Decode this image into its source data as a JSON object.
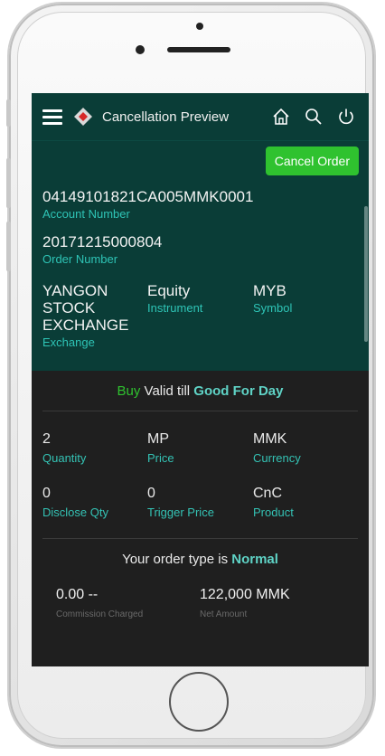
{
  "header": {
    "title": "Cancellation Preview"
  },
  "actions": {
    "cancel_order": "Cancel Order"
  },
  "account": {
    "value": "04149101821CA005MMK0001",
    "label": "Account Number"
  },
  "order": {
    "value": "20171215000804",
    "label": "Order Number"
  },
  "exchange": {
    "value_lines": [
      "YANGON",
      "STOCK",
      "EXCHANGE"
    ],
    "label": "Exchange"
  },
  "instrument": {
    "value": "Equity",
    "label": "Instrument"
  },
  "symbol": {
    "value": "MYB",
    "label": "Symbol"
  },
  "validity": {
    "side": "Buy",
    "text": "Valid till",
    "period": "Good For Day"
  },
  "quantity": {
    "value": "2",
    "label": "Quantity"
  },
  "price": {
    "value": "MP",
    "label": "Price"
  },
  "currency": {
    "value": "MMK",
    "label": "Currency"
  },
  "disclose": {
    "value": "0",
    "label": "Disclose Qty"
  },
  "trigger": {
    "value": "0",
    "label": "Trigger Price"
  },
  "product": {
    "value": "CnC",
    "label": "Product"
  },
  "order_type": {
    "prefix": "Your order type is",
    "value": "Normal"
  },
  "commission": {
    "value": "0.00 --",
    "label": "Commission Charged"
  },
  "net_amount": {
    "value": "122,000 MMK",
    "label": "Net Amount"
  },
  "icons": {
    "menu": "menu-icon",
    "logo": "app-logo-icon",
    "home": "home-icon",
    "search": "search-icon",
    "power": "power-icon"
  },
  "colors": {
    "header_bg": "#0a3d37",
    "accent_green": "#2fc22f",
    "label_teal": "#34c2b4",
    "body_bg": "#1f1f1f"
  }
}
